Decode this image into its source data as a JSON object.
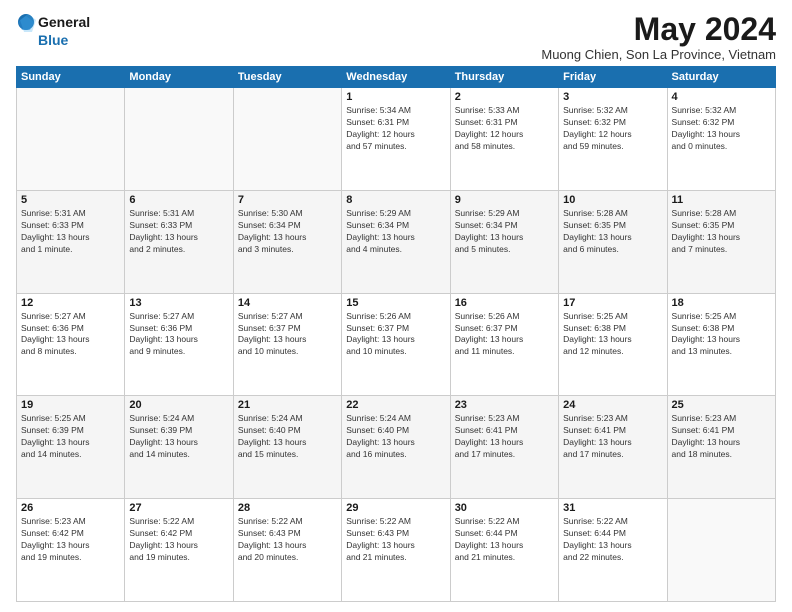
{
  "logo": {
    "general": "General",
    "blue": "Blue"
  },
  "title": "May 2024",
  "subtitle": "Muong Chien, Son La Province, Vietnam",
  "days_header": [
    "Sunday",
    "Monday",
    "Tuesday",
    "Wednesday",
    "Thursday",
    "Friday",
    "Saturday"
  ],
  "weeks": [
    [
      {
        "day": "",
        "info": ""
      },
      {
        "day": "",
        "info": ""
      },
      {
        "day": "",
        "info": ""
      },
      {
        "day": "1",
        "info": "Sunrise: 5:34 AM\nSunset: 6:31 PM\nDaylight: 12 hours\nand 57 minutes."
      },
      {
        "day": "2",
        "info": "Sunrise: 5:33 AM\nSunset: 6:31 PM\nDaylight: 12 hours\nand 58 minutes."
      },
      {
        "day": "3",
        "info": "Sunrise: 5:32 AM\nSunset: 6:32 PM\nDaylight: 12 hours\nand 59 minutes."
      },
      {
        "day": "4",
        "info": "Sunrise: 5:32 AM\nSunset: 6:32 PM\nDaylight: 13 hours\nand 0 minutes."
      }
    ],
    [
      {
        "day": "5",
        "info": "Sunrise: 5:31 AM\nSunset: 6:33 PM\nDaylight: 13 hours\nand 1 minute."
      },
      {
        "day": "6",
        "info": "Sunrise: 5:31 AM\nSunset: 6:33 PM\nDaylight: 13 hours\nand 2 minutes."
      },
      {
        "day": "7",
        "info": "Sunrise: 5:30 AM\nSunset: 6:34 PM\nDaylight: 13 hours\nand 3 minutes."
      },
      {
        "day": "8",
        "info": "Sunrise: 5:29 AM\nSunset: 6:34 PM\nDaylight: 13 hours\nand 4 minutes."
      },
      {
        "day": "9",
        "info": "Sunrise: 5:29 AM\nSunset: 6:34 PM\nDaylight: 13 hours\nand 5 minutes."
      },
      {
        "day": "10",
        "info": "Sunrise: 5:28 AM\nSunset: 6:35 PM\nDaylight: 13 hours\nand 6 minutes."
      },
      {
        "day": "11",
        "info": "Sunrise: 5:28 AM\nSunset: 6:35 PM\nDaylight: 13 hours\nand 7 minutes."
      }
    ],
    [
      {
        "day": "12",
        "info": "Sunrise: 5:27 AM\nSunset: 6:36 PM\nDaylight: 13 hours\nand 8 minutes."
      },
      {
        "day": "13",
        "info": "Sunrise: 5:27 AM\nSunset: 6:36 PM\nDaylight: 13 hours\nand 9 minutes."
      },
      {
        "day": "14",
        "info": "Sunrise: 5:27 AM\nSunset: 6:37 PM\nDaylight: 13 hours\nand 10 minutes."
      },
      {
        "day": "15",
        "info": "Sunrise: 5:26 AM\nSunset: 6:37 PM\nDaylight: 13 hours\nand 10 minutes."
      },
      {
        "day": "16",
        "info": "Sunrise: 5:26 AM\nSunset: 6:37 PM\nDaylight: 13 hours\nand 11 minutes."
      },
      {
        "day": "17",
        "info": "Sunrise: 5:25 AM\nSunset: 6:38 PM\nDaylight: 13 hours\nand 12 minutes."
      },
      {
        "day": "18",
        "info": "Sunrise: 5:25 AM\nSunset: 6:38 PM\nDaylight: 13 hours\nand 13 minutes."
      }
    ],
    [
      {
        "day": "19",
        "info": "Sunrise: 5:25 AM\nSunset: 6:39 PM\nDaylight: 13 hours\nand 14 minutes."
      },
      {
        "day": "20",
        "info": "Sunrise: 5:24 AM\nSunset: 6:39 PM\nDaylight: 13 hours\nand 14 minutes."
      },
      {
        "day": "21",
        "info": "Sunrise: 5:24 AM\nSunset: 6:40 PM\nDaylight: 13 hours\nand 15 minutes."
      },
      {
        "day": "22",
        "info": "Sunrise: 5:24 AM\nSunset: 6:40 PM\nDaylight: 13 hours\nand 16 minutes."
      },
      {
        "day": "23",
        "info": "Sunrise: 5:23 AM\nSunset: 6:41 PM\nDaylight: 13 hours\nand 17 minutes."
      },
      {
        "day": "24",
        "info": "Sunrise: 5:23 AM\nSunset: 6:41 PM\nDaylight: 13 hours\nand 17 minutes."
      },
      {
        "day": "25",
        "info": "Sunrise: 5:23 AM\nSunset: 6:41 PM\nDaylight: 13 hours\nand 18 minutes."
      }
    ],
    [
      {
        "day": "26",
        "info": "Sunrise: 5:23 AM\nSunset: 6:42 PM\nDaylight: 13 hours\nand 19 minutes."
      },
      {
        "day": "27",
        "info": "Sunrise: 5:22 AM\nSunset: 6:42 PM\nDaylight: 13 hours\nand 19 minutes."
      },
      {
        "day": "28",
        "info": "Sunrise: 5:22 AM\nSunset: 6:43 PM\nDaylight: 13 hours\nand 20 minutes."
      },
      {
        "day": "29",
        "info": "Sunrise: 5:22 AM\nSunset: 6:43 PM\nDaylight: 13 hours\nand 21 minutes."
      },
      {
        "day": "30",
        "info": "Sunrise: 5:22 AM\nSunset: 6:44 PM\nDaylight: 13 hours\nand 21 minutes."
      },
      {
        "day": "31",
        "info": "Sunrise: 5:22 AM\nSunset: 6:44 PM\nDaylight: 13 hours\nand 22 minutes."
      },
      {
        "day": "",
        "info": ""
      }
    ]
  ]
}
